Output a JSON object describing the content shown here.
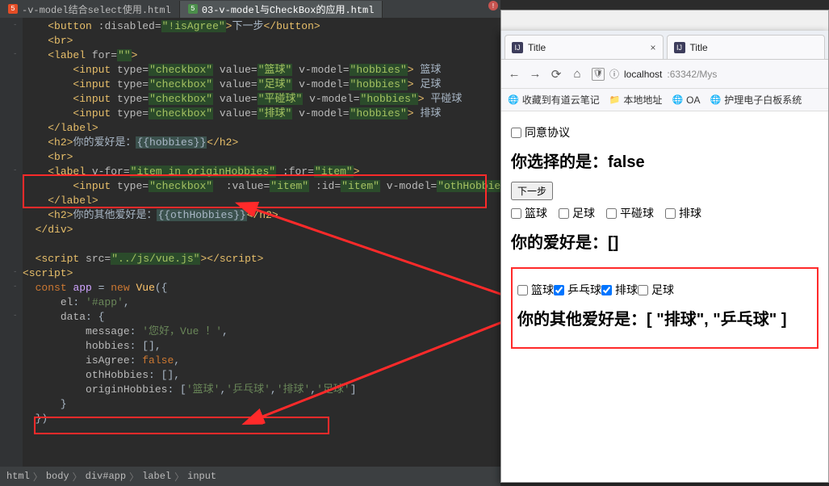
{
  "editor": {
    "tabs": [
      {
        "label": "-v-model结合select使用.html",
        "active": false
      },
      {
        "label": "03-v-model与CheckBox的应用.html",
        "active": true
      }
    ],
    "lines": [
      {
        "indent": 2,
        "html": "<span class='tag'>&lt;button</span> <span class='attr'>:disabled=</span><span class='val'>\"!isAgree\"</span><span class='tag'>&gt;</span><span class='txt'>下一步</span><span class='tag'>&lt;/button&gt;</span>",
        "fold": "-"
      },
      {
        "indent": 2,
        "html": "<span class='tag'>&lt;br&gt;</span>"
      },
      {
        "indent": 2,
        "html": "<span class='tag'>&lt;label</span> <span class='attr'>for=</span><span class='val'>\"\"</span><span class='tag'>&gt;</span>",
        "fold": "-"
      },
      {
        "indent": 4,
        "html": "<span class='tag'>&lt;input</span> <span class='attr'>type=</span><span class='val'>\"checkbox\"</span> <span class='attr'>value=</span><span class='val'>\"篮球\"</span> <span class='attr'>v-model=</span><span class='val'>\"hobbies\"</span><span class='tag'>&gt;</span><span class='txt'> 篮球</span>"
      },
      {
        "indent": 4,
        "html": "<span class='tag'>&lt;input</span> <span class='attr'>type=</span><span class='val'>\"checkbox\"</span> <span class='attr'>value=</span><span class='val'>\"足球\"</span> <span class='attr'>v-model=</span><span class='val'>\"hobbies\"</span><span class='tag'>&gt;</span><span class='txt'> 足球</span>"
      },
      {
        "indent": 4,
        "html": "<span class='tag'>&lt;input</span> <span class='attr'>type=</span><span class='val'>\"checkbox\"</span> <span class='attr'>value=</span><span class='val'>\"平碰球\"</span> <span class='attr'>v-model=</span><span class='val'>\"hobbies\"</span><span class='tag'>&gt;</span><span class='txt'> 平碰球</span>"
      },
      {
        "indent": 4,
        "html": "<span class='tag'>&lt;input</span> <span class='attr'>type=</span><span class='val'>\"checkbox\"</span> <span class='attr'>value=</span><span class='val'>\"排球\"</span> <span class='attr'>v-model=</span><span class='val'>\"hobbies\"</span><span class='tag'>&gt;</span><span class='txt'> 排球</span>"
      },
      {
        "indent": 2,
        "html": "<span class='tag'>&lt;/label&gt;</span>"
      },
      {
        "indent": 2,
        "html": "<span class='tag'>&lt;h2&gt;</span><span class='txt'>你的爱好是：</span><span class='mus'>{{hobbies}}</span><span class='tag'>&lt;/h2&gt;</span>"
      },
      {
        "indent": 2,
        "html": "<span class='tag'>&lt;br&gt;</span>"
      },
      {
        "indent": 2,
        "html": "<span class='tag'>&lt;label</span> <span class='attr'>v-for=</span><span class='val'>\"item in originHobbies\"</span> <span class='attr'>:for=</span><span class='val'>\"item\"</span><span class='tag'>&gt;</span>",
        "fold": "-"
      },
      {
        "indent": 4,
        "html": "<span class='tag'>&lt;input</span> <span class='attr'>type=</span><span class='val'>\"checkbox\"</span>  <span class='attr'>:value=</span><span class='val'>\"item\"</span> <span class='attr'>:id=</span><span class='val'>\"item\"</span> <span class='attr'>v-model=</span><span class='val'>\"othHobbies\"</span><span class='tag'>&gt;</span><span class='mus'>{{item}}</span>"
      },
      {
        "indent": 2,
        "html": "<span class='tag'>&lt;/label&gt;</span>"
      },
      {
        "indent": 2,
        "html": "<span class='tag'>&lt;h2&gt;</span><span class='txt'>你的其他爱好是：</span><span class='mus'>{{othHobbies}}</span><span class='tag'>&lt;/h2&gt;</span>"
      },
      {
        "indent": 1,
        "html": "<span class='tag'>&lt;/div&gt;</span>"
      },
      {
        "indent": 0,
        "html": "&nbsp;"
      },
      {
        "indent": 1,
        "html": "<span class='tag'>&lt;script</span> <span class='attr'>src=</span><span class='val'>\"../js/vue.js\"</span><span class='tag'>&gt;&lt;/script&gt;</span>"
      },
      {
        "indent": 0,
        "html": "<span class='tag'>&lt;script&gt;</span>",
        "fold": "-"
      },
      {
        "indent": 1,
        "html": "<span class='kw'>const</span> <span class='id'>app</span> = <span class='kw'>new</span> <span class='fn'>Vue</span>({",
        "fold": "-"
      },
      {
        "indent": 3,
        "html": "<span class='attr'>el</span>: <span class='str'>'#app'</span>,"
      },
      {
        "indent": 3,
        "html": "<span class='attr'>data</span>: {",
        "fold": "-"
      },
      {
        "indent": 5,
        "html": "<span class='attr'>message</span>: <span class='str'>'您好，Vue ！'</span>,"
      },
      {
        "indent": 5,
        "html": "<span class='attr'>hobbies</span>: [],"
      },
      {
        "indent": 5,
        "html": "<span class='attr'>isAgree</span>: <span class='kw'>false</span>,"
      },
      {
        "indent": 5,
        "html": "<span class='attr'>othHobbies</span>: [],"
      },
      {
        "indent": 5,
        "html": "<span class='attr'>originHobbies</span>: [<span class='str'>'篮球'</span>,<span class='str'>'乒乓球'</span>,<span class='str'>'排球'</span>,<span class='str'>'足球'</span>]"
      },
      {
        "indent": 3,
        "html": "}"
      },
      {
        "indent": 1,
        "html": "})"
      }
    ],
    "breadcrumbs": [
      "html",
      "body",
      "div#app",
      "label",
      "input"
    ]
  },
  "browser": {
    "tabs": [
      {
        "title": "Title",
        "close": "×"
      },
      {
        "title": "Title"
      }
    ],
    "nav": {
      "back": "←",
      "forward": "→",
      "reload": "⟳",
      "home": "⌂"
    },
    "url": {
      "shield": "🛡",
      "info": "ⓘ",
      "host": "localhost",
      "port": ":63342/Mys"
    },
    "bookmarks": [
      {
        "icon": "🌐",
        "label": "收藏到有道云笔记"
      },
      {
        "icon": "📁",
        "label": "本地地址"
      },
      {
        "icon": "🌐",
        "label": "OA"
      },
      {
        "icon": "🌐",
        "label": "护理电子白板系统"
      }
    ],
    "page": {
      "agree_label": "同意协议",
      "h_choice": "你选择的是：false",
      "next_btn": "下一步",
      "hobbies": [
        "篮球",
        "足球",
        "平碰球",
        "排球"
      ],
      "h_hobby": "你的爱好是：[]",
      "other_hobbies": [
        {
          "label": "篮球",
          "checked": false
        },
        {
          "label": "乒乓球",
          "checked": true
        },
        {
          "label": "排球",
          "checked": true
        },
        {
          "label": "足球",
          "checked": false
        }
      ],
      "h_other": "你的其他爱好是：[ \"排球\", \"乒乓球\" ]"
    }
  }
}
